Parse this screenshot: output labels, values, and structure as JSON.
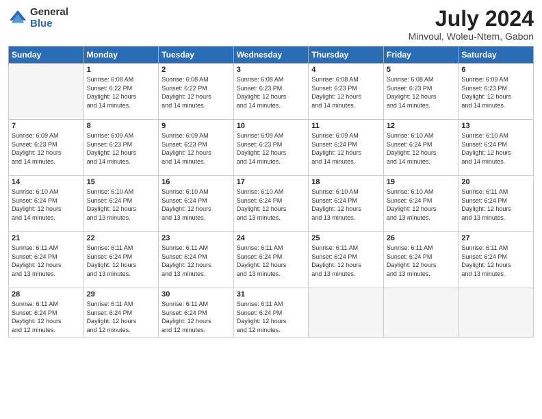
{
  "logo": {
    "general": "General",
    "blue": "Blue"
  },
  "title": "July 2024",
  "subtitle": "Minvoul, Woleu-Ntem, Gabon",
  "days_of_week": [
    "Sunday",
    "Monday",
    "Tuesday",
    "Wednesday",
    "Thursday",
    "Friday",
    "Saturday"
  ],
  "weeks": [
    [
      {
        "day": "",
        "info": ""
      },
      {
        "day": "1",
        "info": "Sunrise: 6:08 AM\nSunset: 6:22 PM\nDaylight: 12 hours\nand 14 minutes."
      },
      {
        "day": "2",
        "info": "Sunrise: 6:08 AM\nSunset: 6:22 PM\nDaylight: 12 hours\nand 14 minutes."
      },
      {
        "day": "3",
        "info": "Sunrise: 6:08 AM\nSunset: 6:23 PM\nDaylight: 12 hours\nand 14 minutes."
      },
      {
        "day": "4",
        "info": "Sunrise: 6:08 AM\nSunset: 6:23 PM\nDaylight: 12 hours\nand 14 minutes."
      },
      {
        "day": "5",
        "info": "Sunrise: 6:08 AM\nSunset: 6:23 PM\nDaylight: 12 hours\nand 14 minutes."
      },
      {
        "day": "6",
        "info": "Sunrise: 6:09 AM\nSunset: 6:23 PM\nDaylight: 12 hours\nand 14 minutes."
      }
    ],
    [
      {
        "day": "7",
        "info": "Sunrise: 6:09 AM\nSunset: 6:23 PM\nDaylight: 12 hours\nand 14 minutes."
      },
      {
        "day": "8",
        "info": "Sunrise: 6:09 AM\nSunset: 6:23 PM\nDaylight: 12 hours\nand 14 minutes."
      },
      {
        "day": "9",
        "info": "Sunrise: 6:09 AM\nSunset: 6:23 PM\nDaylight: 12 hours\nand 14 minutes."
      },
      {
        "day": "10",
        "info": "Sunrise: 6:09 AM\nSunset: 6:23 PM\nDaylight: 12 hours\nand 14 minutes."
      },
      {
        "day": "11",
        "info": "Sunrise: 6:09 AM\nSunset: 6:24 PM\nDaylight: 12 hours\nand 14 minutes."
      },
      {
        "day": "12",
        "info": "Sunrise: 6:10 AM\nSunset: 6:24 PM\nDaylight: 12 hours\nand 14 minutes."
      },
      {
        "day": "13",
        "info": "Sunrise: 6:10 AM\nSunset: 6:24 PM\nDaylight: 12 hours\nand 14 minutes."
      }
    ],
    [
      {
        "day": "14",
        "info": "Sunrise: 6:10 AM\nSunset: 6:24 PM\nDaylight: 12 hours\nand 14 minutes."
      },
      {
        "day": "15",
        "info": "Sunrise: 6:10 AM\nSunset: 6:24 PM\nDaylight: 12 hours\nand 13 minutes."
      },
      {
        "day": "16",
        "info": "Sunrise: 6:10 AM\nSunset: 6:24 PM\nDaylight: 12 hours\nand 13 minutes."
      },
      {
        "day": "17",
        "info": "Sunrise: 6:10 AM\nSunset: 6:24 PM\nDaylight: 12 hours\nand 13 minutes."
      },
      {
        "day": "18",
        "info": "Sunrise: 6:10 AM\nSunset: 6:24 PM\nDaylight: 12 hours\nand 13 minutes."
      },
      {
        "day": "19",
        "info": "Sunrise: 6:10 AM\nSunset: 6:24 PM\nDaylight: 12 hours\nand 13 minutes."
      },
      {
        "day": "20",
        "info": "Sunrise: 6:11 AM\nSunset: 6:24 PM\nDaylight: 12 hours\nand 13 minutes."
      }
    ],
    [
      {
        "day": "21",
        "info": "Sunrise: 6:11 AM\nSunset: 6:24 PM\nDaylight: 12 hours\nand 13 minutes."
      },
      {
        "day": "22",
        "info": "Sunrise: 6:11 AM\nSunset: 6:24 PM\nDaylight: 12 hours\nand 13 minutes."
      },
      {
        "day": "23",
        "info": "Sunrise: 6:11 AM\nSunset: 6:24 PM\nDaylight: 12 hours\nand 13 minutes."
      },
      {
        "day": "24",
        "info": "Sunrise: 6:11 AM\nSunset: 6:24 PM\nDaylight: 12 hours\nand 13 minutes."
      },
      {
        "day": "25",
        "info": "Sunrise: 6:11 AM\nSunset: 6:24 PM\nDaylight: 12 hours\nand 13 minutes."
      },
      {
        "day": "26",
        "info": "Sunrise: 6:11 AM\nSunset: 6:24 PM\nDaylight: 12 hours\nand 13 minutes."
      },
      {
        "day": "27",
        "info": "Sunrise: 6:11 AM\nSunset: 6:24 PM\nDaylight: 12 hours\nand 13 minutes."
      }
    ],
    [
      {
        "day": "28",
        "info": "Sunrise: 6:11 AM\nSunset: 6:24 PM\nDaylight: 12 hours\nand 12 minutes."
      },
      {
        "day": "29",
        "info": "Sunrise: 6:11 AM\nSunset: 6:24 PM\nDaylight: 12 hours\nand 12 minutes."
      },
      {
        "day": "30",
        "info": "Sunrise: 6:11 AM\nSunset: 6:24 PM\nDaylight: 12 hours\nand 12 minutes."
      },
      {
        "day": "31",
        "info": "Sunrise: 6:11 AM\nSunset: 6:24 PM\nDaylight: 12 hours\nand 12 minutes."
      },
      {
        "day": "",
        "info": ""
      },
      {
        "day": "",
        "info": ""
      },
      {
        "day": "",
        "info": ""
      }
    ]
  ]
}
